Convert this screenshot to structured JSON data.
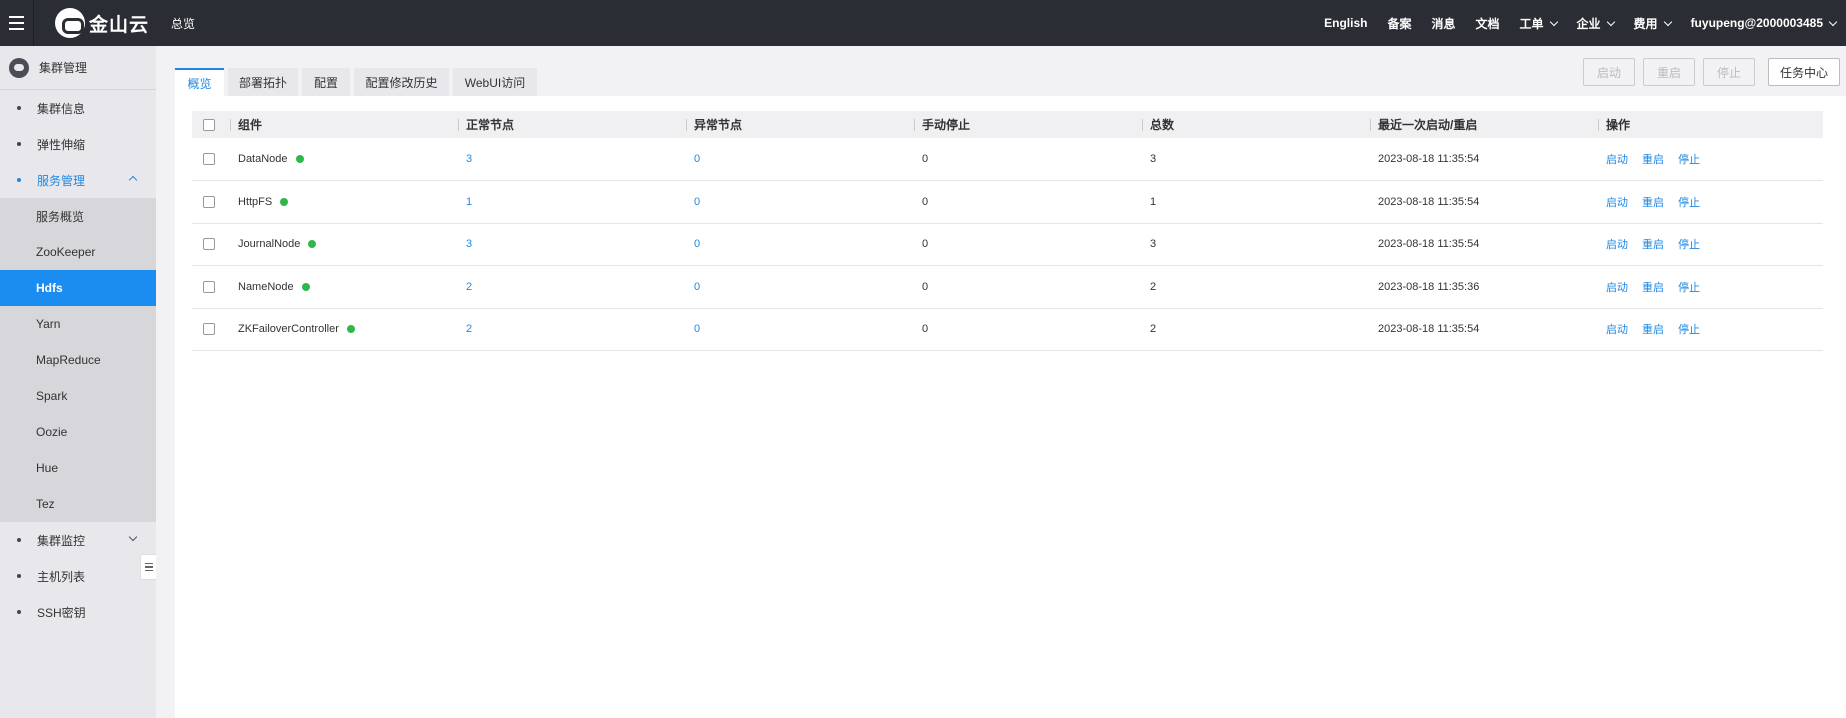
{
  "topbar": {
    "logo_text": "金山云",
    "home_link": "总览",
    "right_items": [
      {
        "label": "English",
        "has_dropdown": false
      },
      {
        "label": "备案",
        "has_dropdown": false
      },
      {
        "label": "消息",
        "has_dropdown": false
      },
      {
        "label": "文档",
        "has_dropdown": false
      },
      {
        "label": "工单",
        "has_dropdown": true
      },
      {
        "label": "企业",
        "has_dropdown": true
      },
      {
        "label": "费用",
        "has_dropdown": true
      },
      {
        "label": "fuyupeng@2000003485",
        "has_dropdown": true
      }
    ]
  },
  "sidebar": {
    "header": "集群管理",
    "items_top": [
      {
        "label": "集群信息"
      },
      {
        "label": "弹性伸缩"
      },
      {
        "label": "服务管理"
      }
    ],
    "sub_items": [
      "服务概览",
      "ZooKeeper",
      "Hdfs",
      "Yarn",
      "MapReduce",
      "Spark",
      "Oozie",
      "Hue",
      "Tez"
    ],
    "selected_sub": "Hdfs",
    "items_bottom": [
      {
        "label": "集群监控"
      },
      {
        "label": "主机列表"
      },
      {
        "label": "SSH密钥"
      }
    ]
  },
  "tabs": [
    "概览",
    "部署拓扑",
    "配置",
    "配置修改历史",
    "WebUI访问"
  ],
  "active_tab": "概览",
  "actions": [
    "启动",
    "重启",
    "停止",
    "任务中心"
  ],
  "table": {
    "columns": [
      "组件",
      "正常节点",
      "异常节点",
      "手动停止",
      "总数",
      "最近一次启动/重启",
      "操作"
    ],
    "rows": [
      {
        "component": "DataNode",
        "normal": "3",
        "abnormal": "0",
        "stopped": "0",
        "total": "3",
        "last_start": "2023-08-18 11:35:54"
      },
      {
        "component": "HttpFS",
        "normal": "1",
        "abnormal": "0",
        "stopped": "0",
        "total": "1",
        "last_start": "2023-08-18 11:35:54"
      },
      {
        "component": "JournalNode",
        "normal": "3",
        "abnormal": "0",
        "stopped": "0",
        "total": "3",
        "last_start": "2023-08-18 11:35:54"
      },
      {
        "component": "NameNode",
        "normal": "2",
        "abnormal": "0",
        "stopped": "0",
        "total": "2",
        "last_start": "2023-08-18 11:35:36"
      },
      {
        "component": "ZKFailoverController",
        "normal": "2",
        "abnormal": "0",
        "stopped": "0",
        "total": "2",
        "last_start": "2023-08-18 11:35:54"
      }
    ],
    "row_ops": [
      "启动",
      "重启",
      "停止"
    ]
  },
  "colors": {
    "accent": "#1e88e5",
    "topbar": "#2a2d33",
    "status_ok": "#2eb84b"
  }
}
